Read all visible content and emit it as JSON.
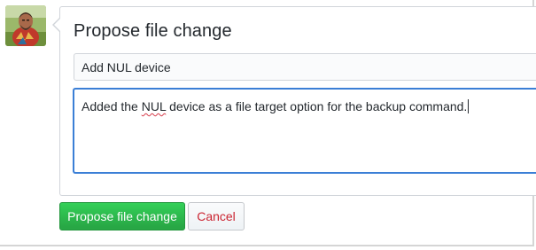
{
  "avatar": {
    "icon": "user-avatar-icon"
  },
  "form": {
    "title": "Propose file change",
    "commit_title_value": "Add NUL device",
    "commit_description_before": "Added the ",
    "commit_description_misspelled": "NUL",
    "commit_description_after": " device as a file target option for the backup command."
  },
  "actions": {
    "propose_label": "Propose file change",
    "cancel_label": "Cancel"
  },
  "colors": {
    "primary_green": "#28a745",
    "cancel_red": "#cb2431",
    "focus_blue": "#3b7fd6",
    "border_gray": "#d1d5da"
  }
}
